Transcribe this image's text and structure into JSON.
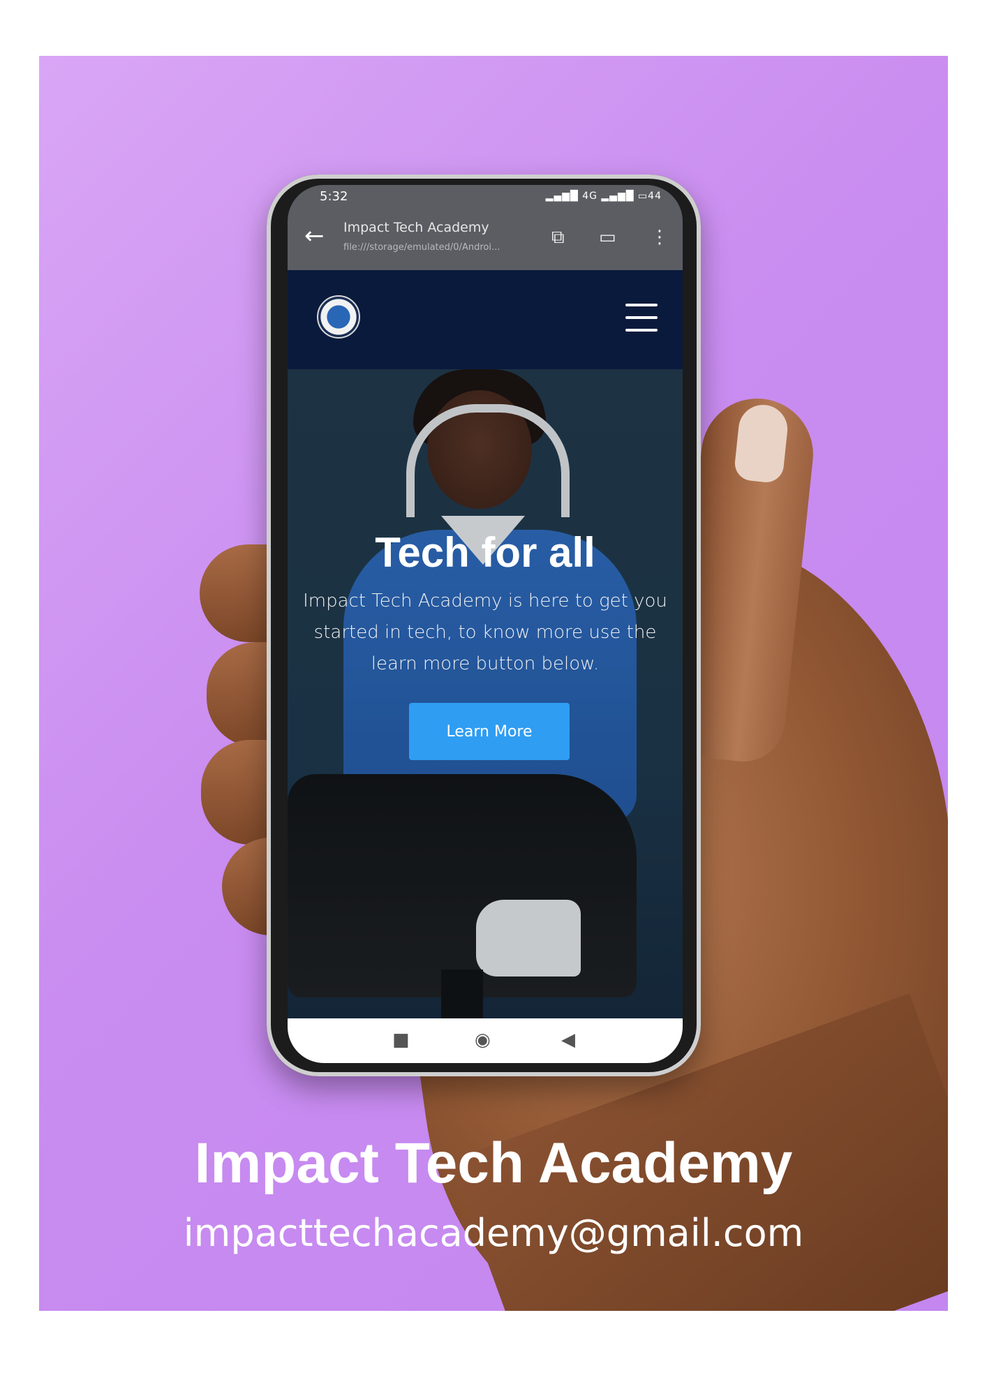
{
  "phone": {
    "status_time": "5:32",
    "status_signal": "4G",
    "battery": "44",
    "browser": {
      "title": "Impact Tech Academy",
      "url": "file:///storage/emulated/0/Androi..."
    },
    "hero": {
      "title": "Tech for all",
      "text": "Impact Tech Academy is here to get you started in tech, to know more use the learn more button below.",
      "button_label": "Learn More"
    }
  },
  "poster": {
    "brand": "Impact Tech Academy",
    "email": "impacttechacademy@gmail.com"
  },
  "colors": {
    "background": "#c98cf0",
    "site_nav": "#0a1a3c",
    "button": "#2f9df2"
  }
}
